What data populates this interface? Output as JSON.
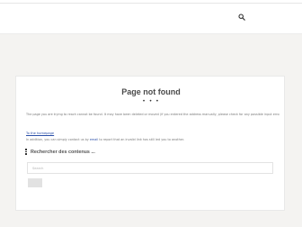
{
  "header": {
    "search_icon": "search-icon"
  },
  "content": {
    "title": "Page not found",
    "separator": "• • •",
    "message": "The page you are trying to reach cannot be found. It may have been deleted or moved (if you entered the address manually, please check for any possible input error).",
    "home_link": "To the homepage",
    "contact_prefix": "In addition, you can simply contact us by ",
    "contact_link": "email",
    "contact_suffix": " to report that an invalid link has still led you to another.",
    "search_heading": "Rechercher des contenus ...",
    "search_placeholder": "Search",
    "submit_label": ""
  },
  "colors": {
    "background": "#f4f3f1",
    "link": "#2a4fa8",
    "title": "#4a4a4a"
  }
}
